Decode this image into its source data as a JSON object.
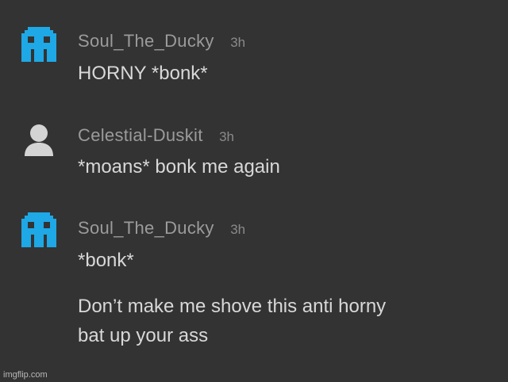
{
  "colors": {
    "background": "#333333",
    "username": "#9b9b9b",
    "timestamp": "#8a8a8a",
    "message_text": "#d8d8d8",
    "pixel_avatar": "#1ea8e6",
    "default_avatar": "#d4d4d4"
  },
  "comments": [
    {
      "avatar_icon": "pixel-ghost-icon",
      "username": "Soul_The_Ducky",
      "time": "3h",
      "messages": [
        "HORNY *bonk*"
      ]
    },
    {
      "avatar_icon": "default-user-icon",
      "username": "Celestial-Duskit",
      "time": "3h",
      "messages": [
        "*moans* bonk me again"
      ]
    },
    {
      "avatar_icon": "pixel-ghost-icon",
      "username": "Soul_The_Ducky",
      "time": "3h",
      "messages": [
        "*bonk*",
        "Don’t make me shove this anti horny",
        "bat up your ass"
      ]
    }
  ],
  "watermark": "imgflip.com"
}
